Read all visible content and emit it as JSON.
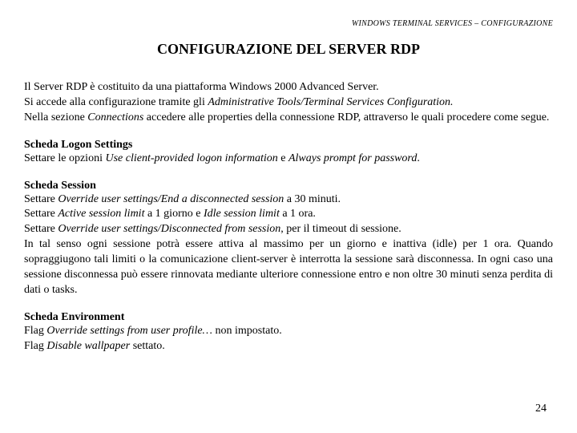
{
  "header": "WINDOWS TERMINAL SERVICES – CONFIGURAZIONE",
  "title": "CONFIGURAZIONE DEL SERVER RDP",
  "intro": {
    "line1_a": "Il Server RDP è costituito da una piattaforma Windows 2000 Advanced Server.",
    "line2_a": "Si accede alla configurazione tramite gli ",
    "line2_i": "Administrative Tools/Terminal Services Configuration.",
    "line3_a": "Nella sezione ",
    "line3_i": "Connections",
    "line3_b": " accedere alle properties della connessione RDP, attraverso le quali procedere come segue."
  },
  "logon": {
    "heading": "Scheda Logon Settings",
    "p1_a": "Settare le opzioni ",
    "p1_i1": "Use client-provided logon information",
    "p1_b": " e ",
    "p1_i2": "Always prompt for password",
    "p1_c": "."
  },
  "session": {
    "heading": "Scheda Session",
    "l1_a": "Settare ",
    "l1_i": "Override user settings/End a disconnected session",
    "l1_b": " a 30 minuti.",
    "l2_a": "Settare ",
    "l2_i1": "Active session limit",
    "l2_b": " a 1 giorno e ",
    "l2_i2": "Idle session limit",
    "l2_c": " a 1 ora.",
    "l3_a": "Settare ",
    "l3_i": "Override user settings/Disconnected from session",
    "l3_b": ", per il timeout di sessione.",
    "l4": "In tal senso ogni sessione potrà essere attiva al massimo per un giorno e inattiva (idle) per 1 ora. Quando sopraggiugono tali limiti o la comunicazione client-server è interrotta la sessione sarà disconnessa. In ogni caso una sessione disconnessa può essere rinnovata mediante ulteriore connessione entro e non oltre 30 minuti senza perdita di dati o tasks."
  },
  "env": {
    "heading": "Scheda Environment",
    "l1_a": "Flag ",
    "l1_i": "Override settings from user profile…",
    "l1_b": " non impostato.",
    "l2_a": "Flag ",
    "l2_i": "Disable wallpaper",
    "l2_b": " settato."
  },
  "page": "24"
}
